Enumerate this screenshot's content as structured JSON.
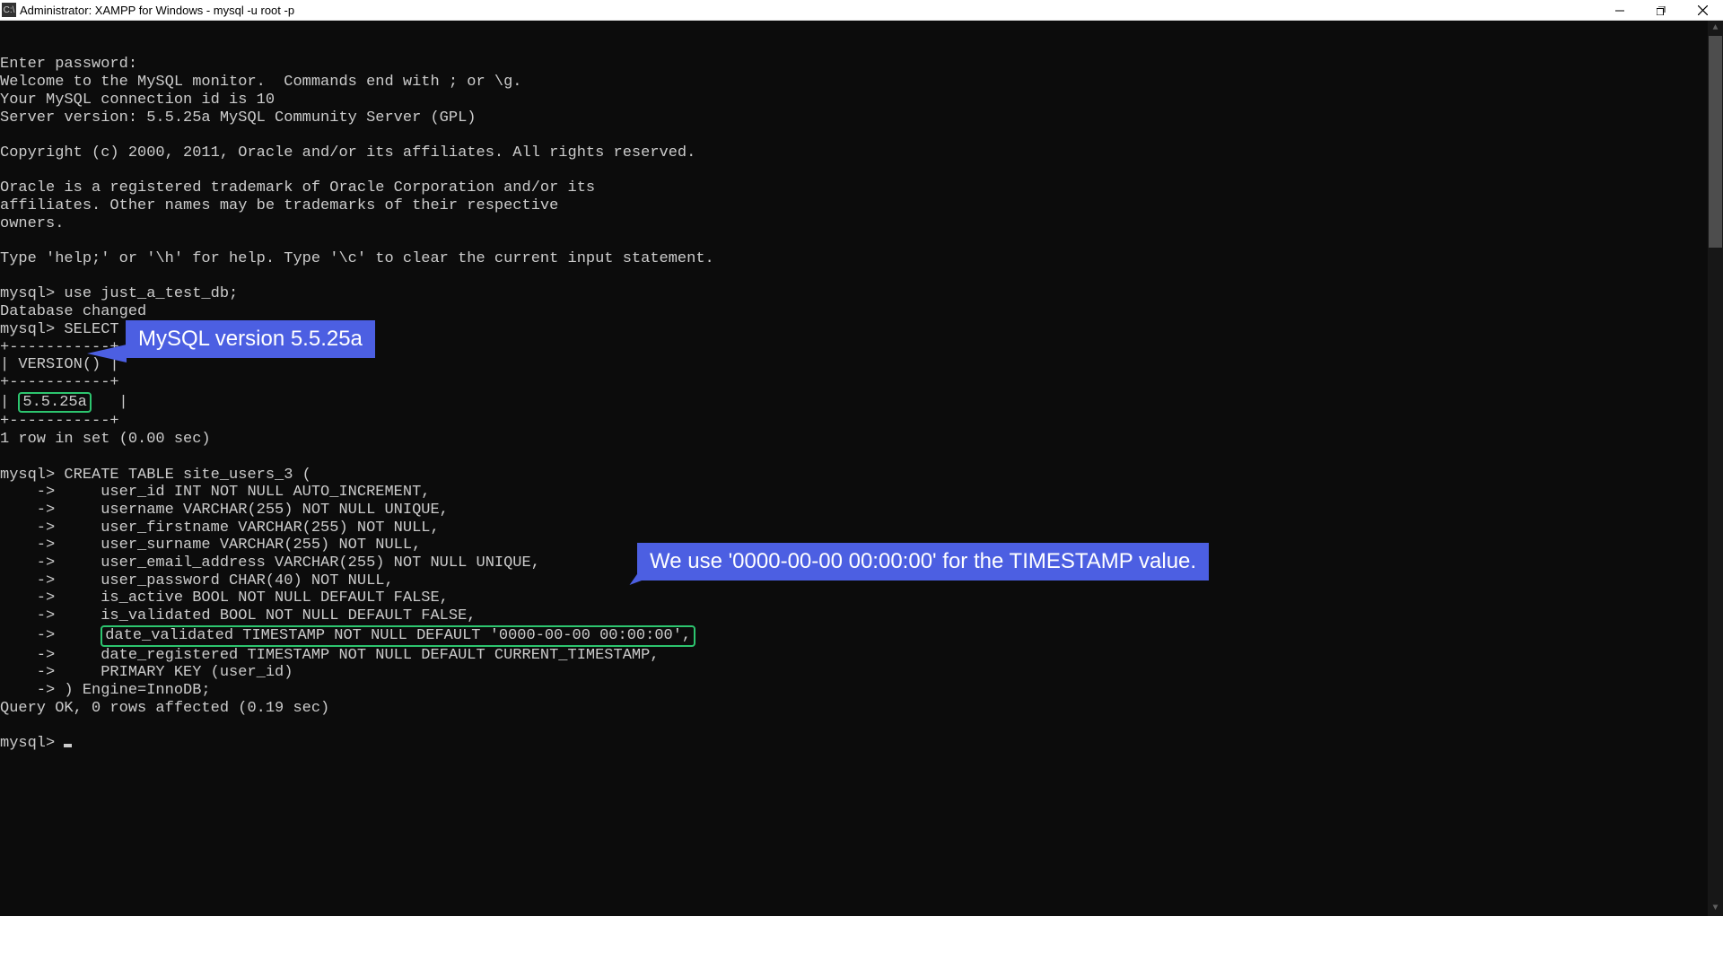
{
  "window": {
    "title": "Administrator:  XAMPP for Windows - mysql  -u root -p",
    "icon_label": "C:\\"
  },
  "terminal": {
    "lines_pre": [
      "Enter password:",
      "Welcome to the MySQL monitor.  Commands end with ; or \\g.",
      "Your MySQL connection id is 10",
      "Server version: 5.5.25a MySQL Community Server (GPL)",
      "",
      "Copyright (c) 2000, 2011, Oracle and/or its affiliates. All rights reserved.",
      "",
      "Oracle is a registered trademark of Oracle Corporation and/or its",
      "affiliates. Other names may be trademarks of their respective",
      "owners.",
      "",
      "Type 'help;' or '\\h' for help. Type '\\c' to clear the current input statement.",
      "",
      "mysql> use just_a_test_db;",
      "Database changed",
      "mysql> SELECT VERSION();",
      "+-----------+",
      "| VERSION() |",
      "+-----------+"
    ],
    "version_left": "| ",
    "version_value": "5.5.25a",
    "version_right": "   |",
    "lines_mid": [
      "+-----------+",
      "1 row in set (0.00 sec)",
      "",
      "mysql> CREATE TABLE site_users_3 (",
      "    ->     user_id INT NOT NULL AUTO_INCREMENT,",
      "    ->     username VARCHAR(255) NOT NULL UNIQUE,",
      "    ->     user_firstname VARCHAR(255) NOT NULL,",
      "    ->     user_surname VARCHAR(255) NOT NULL,",
      "    ->     user_email_address VARCHAR(255) NOT NULL UNIQUE,",
      "    ->     user_password CHAR(40) NOT NULL,",
      "    ->     is_active BOOL NOT NULL DEFAULT FALSE,",
      "    ->     is_validated BOOL NOT NULL DEFAULT FALSE,"
    ],
    "hl_left": "    ->     ",
    "hl_value": "date_validated TIMESTAMP NOT NULL DEFAULT '0000-00-00 00:00:00',",
    "lines_post": [
      "    ->     date_registered TIMESTAMP NOT NULL DEFAULT CURRENT_TIMESTAMP,",
      "    ->     PRIMARY KEY (user_id)",
      "    -> ) Engine=InnoDB;",
      "Query OK, 0 rows affected (0.19 sec)",
      ""
    ],
    "prompt": "mysql> "
  },
  "annotations": {
    "callout1": "MySQL version 5.5.25a",
    "callout2": "We use '0000-00-00 00:00:00' for the TIMESTAMP value."
  }
}
